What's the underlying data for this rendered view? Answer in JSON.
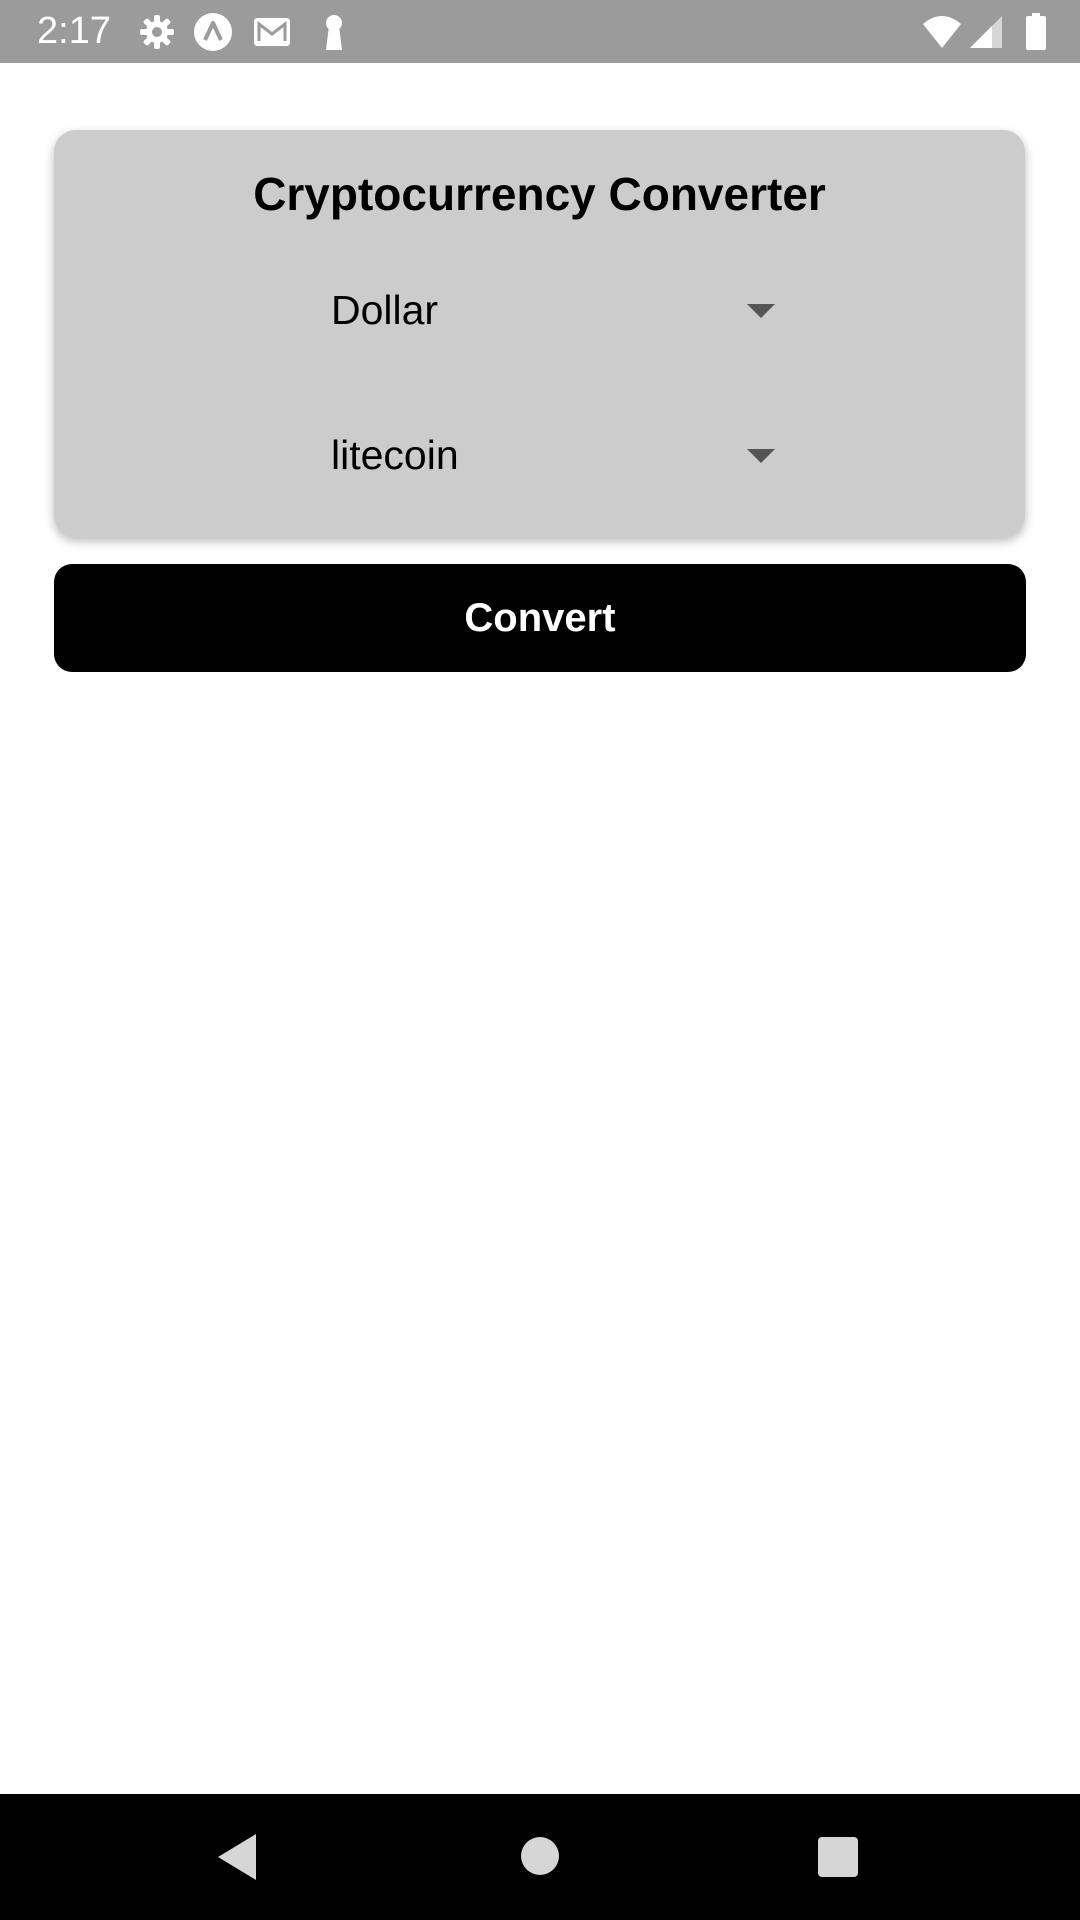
{
  "status_bar": {
    "time": "2:17",
    "icons": [
      "gear-icon",
      "nav-app-icon",
      "gmail-icon",
      "keyhole-icon",
      "wifi-icon",
      "signal-icon",
      "battery-icon"
    ],
    "color": "#9b9b9b"
  },
  "card": {
    "title": "Cryptocurrency Converter",
    "background": "#cccccc",
    "from_picker": {
      "value": "Dollar"
    },
    "to_picker": {
      "value": "litecoin"
    }
  },
  "convert_button": {
    "label": "Convert"
  },
  "nav_bar": {
    "buttons": [
      "back-icon",
      "home-icon",
      "recents-icon"
    ]
  }
}
